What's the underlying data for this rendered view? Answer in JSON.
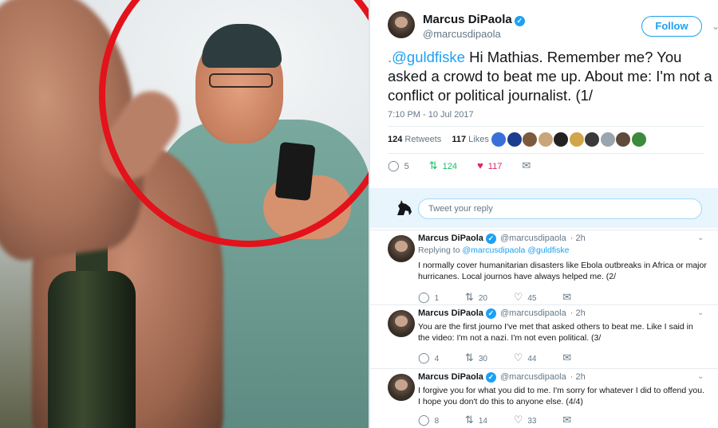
{
  "colors": {
    "accent": "#1da1f2",
    "retweet": "#17bf63",
    "like": "#e0245e",
    "circle": "#e3121b"
  },
  "tweet": {
    "author": {
      "name": "Marcus DiPaola",
      "handle": "@marcusdipaola",
      "verified_icon": "verified-badge-icon"
    },
    "follow_label": "Follow",
    "text": {
      "mention": ".@guldfiske",
      "body": " Hi Mathias. Remember me? You asked a crowd to beat me up. About me: I'm not a conflict or political journalist. (1/"
    },
    "timestamp": "7:10 PM - 10 Jul 2017",
    "stats": {
      "retweets": "124",
      "retweets_label": "Retweets",
      "likes": "117",
      "likes_label": "Likes"
    },
    "likers": [
      "#3a6fd8",
      "#1b3d8f",
      "#7a5b3e",
      "#c9a57b",
      "#222222",
      "#d1a54a",
      "#3a3a3a",
      "#9aa5ad",
      "#5d4a3a",
      "#3c8a3c"
    ],
    "actions": {
      "replies": "5",
      "retweets": "124",
      "likes": "117"
    }
  },
  "reply_box": {
    "placeholder": "Tweet your reply"
  },
  "replies": [
    {
      "name": "Marcus DiPaola",
      "handle": "@marcusdipaola",
      "time": "· 2h",
      "replying_prefix": "Replying to",
      "replying_to": "@marcusdipaola @guldfiske",
      "text": "I normally cover humanitarian disasters like Ebola outbreaks in Africa or major hurricanes. Local journos have always helped me. (2/",
      "counts": {
        "replies": "1",
        "retweets": "20",
        "likes": "45"
      }
    },
    {
      "name": "Marcus DiPaola",
      "handle": "@marcusdipaola",
      "time": "· 2h",
      "text": "You are the first journo I've met that asked others to beat me. Like I said in the video: I'm not a nazi. I'm not even political. (3/",
      "counts": {
        "replies": "4",
        "retweets": "30",
        "likes": "44"
      }
    },
    {
      "name": "Marcus DiPaola",
      "handle": "@marcusdipaola",
      "time": "· 2h",
      "text": "I forgive you for what you did to me. I'm sorry for whatever I did to offend you. I hope you don't do this to anyone else. (4/4)",
      "counts": {
        "replies": "8",
        "retweets": "14",
        "likes": "33"
      }
    }
  ]
}
